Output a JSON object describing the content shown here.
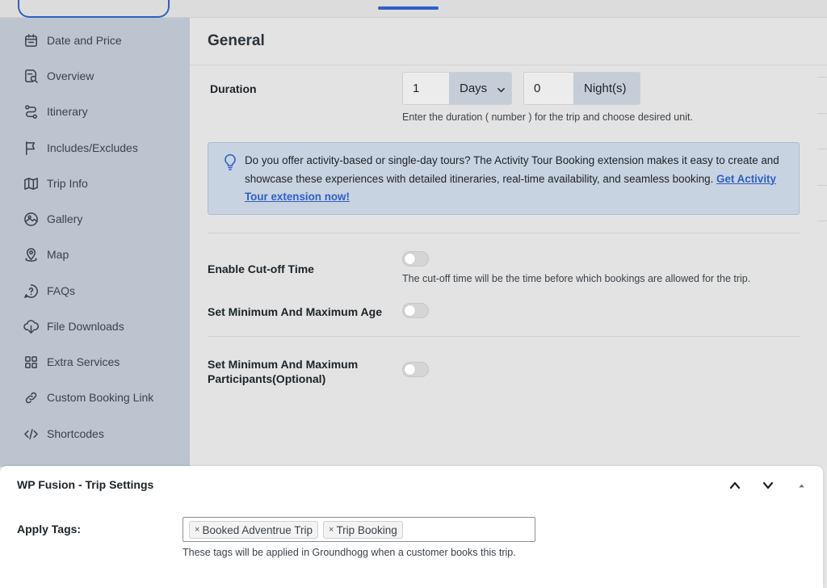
{
  "sidebar": {
    "items": [
      {
        "label": "Date and Price",
        "icon": "calendar-icon"
      },
      {
        "label": "Overview",
        "icon": "document-search-icon"
      },
      {
        "label": "Itinerary",
        "icon": "route-icon"
      },
      {
        "label": "Includes/Excludes",
        "icon": "flag-icon"
      },
      {
        "label": "Trip Info",
        "icon": "map-fold-icon"
      },
      {
        "label": "Gallery",
        "icon": "gallery-icon"
      },
      {
        "label": "Map",
        "icon": "map-pin-icon"
      },
      {
        "label": "FAQs",
        "icon": "question-icon"
      },
      {
        "label": "File Downloads",
        "icon": "download-icon"
      },
      {
        "label": "Extra Services",
        "icon": "grid-icon"
      },
      {
        "label": "Custom Booking Link",
        "icon": "link-icon"
      },
      {
        "label": "Shortcodes",
        "icon": "code-icon"
      }
    ]
  },
  "main": {
    "title": "General",
    "duration": {
      "label": "Duration",
      "days_value": "1",
      "days_unit": "Days",
      "nights_value": "0",
      "nights_unit": "Night(s)",
      "help": "Enter the duration ( number ) for the trip and choose desired unit."
    },
    "notice": {
      "text": "Do you offer activity-based or single-day tours? The Activity Tour Booking extension makes it easy to create and showcase these experiences with detailed itineraries, real-time availability, and seamless booking.",
      "link": "Get Activity Tour extension now!"
    },
    "cutoff": {
      "label": "Enable Cut-off Time",
      "enabled": false,
      "help": "The cut-off time will be the time before which bookings are allowed for the trip."
    },
    "age": {
      "label": "Set Minimum And Maximum Age",
      "enabled": false
    },
    "participants": {
      "label_line1": "Set Minimum And Maximum",
      "label_line2": "Participants(Optional)",
      "enabled": false
    }
  },
  "metabox": {
    "title": "WP Fusion - Trip Settings",
    "apply_tags_label": "Apply Tags:",
    "tags": [
      "Booked Adventrue Trip",
      "Trip Booking"
    ],
    "tag_remove_glyph": "×",
    "help": "These tags will be applied in Groundhogg when a customer books this trip."
  },
  "colors": {
    "accent": "#2f5fc4",
    "sidebar_bg": "#bcc4cf",
    "notice_bg": "#c8d3e2"
  }
}
